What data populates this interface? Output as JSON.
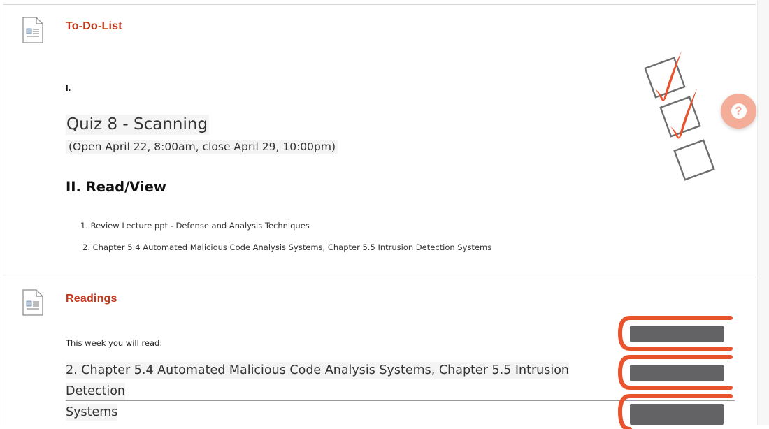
{
  "todo": {
    "title": "To-Do-List",
    "icon": "document-icon",
    "roman_one": "I.",
    "quiz_title": "Quiz 8 - Scanning",
    "quiz_dates": "(Open April 22, 8:00am, close April 29, 10:00pm)",
    "section_heading": "II. Read/View",
    "read_items": [
      "1. Review Lecture ppt - Defense and Analysis Techniques",
      "2. Chapter 5.4 Automated Malicious Code Analysis Systems, Chapter 5.5 Intrusion Detection Systems"
    ],
    "art": "checklist-icon"
  },
  "readings": {
    "title": "Readings",
    "icon": "document-icon",
    "intro": "This week you will read:",
    "chapter_line1": " 2. Chapter 5.4 Automated Malicious Code Analysis Systems, Chapter 5.5 Intrusion Detection",
    "chapter_line2": "Systems",
    "art": "books-icon"
  },
  "help_button": {
    "glyph": "?",
    "icon": "help-icon",
    "color": "#f3ad98"
  },
  "colors": {
    "accent": "#c2371a",
    "checkmark": "#e8522c",
    "books_orange": "#e8522c",
    "books_gray": "#636366"
  }
}
